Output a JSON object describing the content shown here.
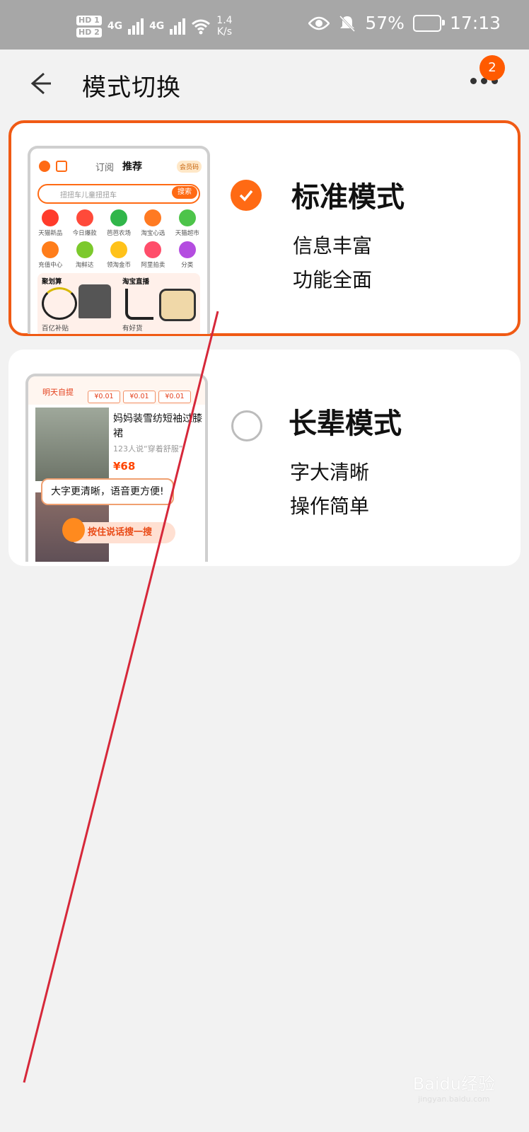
{
  "status_bar": {
    "hd1": "HD 1",
    "hd2": "HD 2",
    "net_type1": "4G",
    "net_type2": "4G",
    "speed": "1.4\nK/s",
    "battery": "57%",
    "time": "17:13"
  },
  "header": {
    "title": "模式切换",
    "notification_count": "2"
  },
  "modes": [
    {
      "name": "标准模式",
      "desc1": "信息丰富",
      "desc2": "功能全面",
      "selected": true,
      "preview": {
        "tab1": "订阅",
        "tab2": "推荐",
        "member": "会员码",
        "search_placeholder": "扭扭车儿童扭扭车",
        "search_button": "搜索",
        "grid": [
          "天猫新品",
          "今日爆款",
          "芭芭农场",
          "淘宝心选",
          "天猫超市",
          "充值中心",
          "淘鲜达",
          "领淘金币",
          "阿里拍卖",
          "分类"
        ],
        "promo1": "聚划算",
        "promo2": "淘宝直播",
        "promo3": "百亿补贴",
        "promo4": "有好货"
      }
    },
    {
      "name": "长辈模式",
      "desc1": "字大清晰",
      "desc2": "操作简单",
      "selected": false,
      "preview": {
        "label": "明天自提",
        "prices": [
          "¥0.01",
          "¥0.01",
          "¥0.01"
        ],
        "product": "妈妈装雪纺短袖过膝裙",
        "sub": "123人说“穿着舒服”",
        "price": "¥68",
        "tip": "大字更清晰，语音更方便!",
        "voice": "按住说话搜一搜"
      }
    }
  ],
  "watermark": {
    "brand": "Baidu经验",
    "url": "jingyan.baidu.com"
  },
  "colors": {
    "accent": "#ff6a14",
    "selected_border": "#f05a14",
    "badge": "#ff5a00"
  }
}
